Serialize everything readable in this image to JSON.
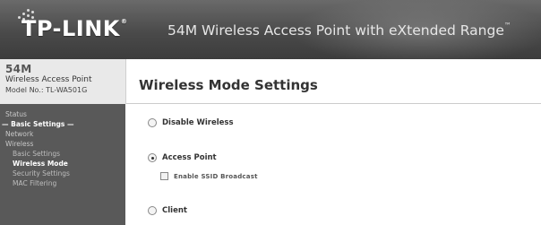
{
  "header": {
    "brand": "TP-LINK",
    "brand_mark": "®",
    "tagline": "54M Wireless Access Point with eXtended Range",
    "tagline_mark": "™"
  },
  "sidebar": {
    "product_model": "54M",
    "product_name": "Wireless Access Point",
    "model_no": "Model No.: TL-WA501G",
    "menu": [
      {
        "label": "Status",
        "kind": "item"
      },
      {
        "label": "— Basic Settings —",
        "kind": "section"
      },
      {
        "label": "Network",
        "kind": "item"
      },
      {
        "label": "Wireless",
        "kind": "item"
      },
      {
        "label": "Basic Settings",
        "kind": "sub"
      },
      {
        "label": "Wireless Mode",
        "kind": "sub-active"
      },
      {
        "label": "Security Settings",
        "kind": "sub"
      },
      {
        "label": "MAC Filtering",
        "kind": "sub"
      }
    ]
  },
  "main": {
    "title": "Wireless Mode Settings",
    "options": {
      "disable": {
        "label": "Disable Wireless",
        "checked": false
      },
      "access_point": {
        "label": "Access Point",
        "checked": true
      },
      "ssid_broadcast": {
        "label": "Enable SSID Broadcast",
        "checked": false
      },
      "client": {
        "label": "Client",
        "checked": false
      }
    }
  },
  "colors": {
    "header_bg": "#4a4a4a",
    "sidebar_bg": "#595959",
    "content_bg": "#ffffff"
  }
}
